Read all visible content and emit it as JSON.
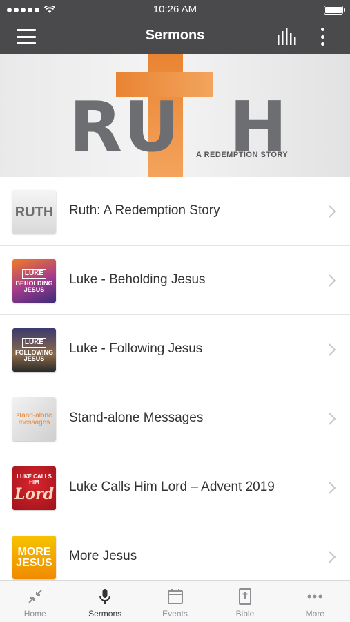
{
  "status_bar": {
    "time": "10:26 AM"
  },
  "nav": {
    "title": "Sermons"
  },
  "banner": {
    "title_letters_left": "RU",
    "title_letters_right": "H",
    "subtitle": "A REDEMPTION STORY"
  },
  "series": [
    {
      "label": "Ruth: A Redemption Story",
      "thumb_text": "RUTH"
    },
    {
      "label": "Luke - Beholding Jesus",
      "thumb_text_1": "LUKE",
      "thumb_text_2": "BEHOLDING",
      "thumb_text_3": "JESUS"
    },
    {
      "label": "Luke - Following Jesus",
      "thumb_text_1": "LUKE",
      "thumb_text_2": "FOLLOWING",
      "thumb_text_3": "JESUS"
    },
    {
      "label": "Stand-alone Messages",
      "thumb_text_1": "stand-alone",
      "thumb_text_2": "messages"
    },
    {
      "label": "Luke Calls Him Lord – Advent 2019",
      "thumb_text_1": "LUKE CALLS HIM",
      "thumb_text_2": "Lord"
    },
    {
      "label": "More Jesus",
      "thumb_text_1": "MORE",
      "thumb_text_2": "JESUS"
    }
  ],
  "tabs": [
    {
      "label": "Home",
      "icon": "collapse-arrows-icon"
    },
    {
      "label": "Sermons",
      "icon": "microphone-icon"
    },
    {
      "label": "Events",
      "icon": "calendar-icon"
    },
    {
      "label": "Bible",
      "icon": "bible-icon"
    },
    {
      "label": "More",
      "icon": "more-dots-icon"
    }
  ],
  "colors": {
    "nav_bg": "#4a4a4d",
    "accent_orange": "#e98432",
    "tab_active": "#333333",
    "tab_inactive": "#8e8e93"
  }
}
